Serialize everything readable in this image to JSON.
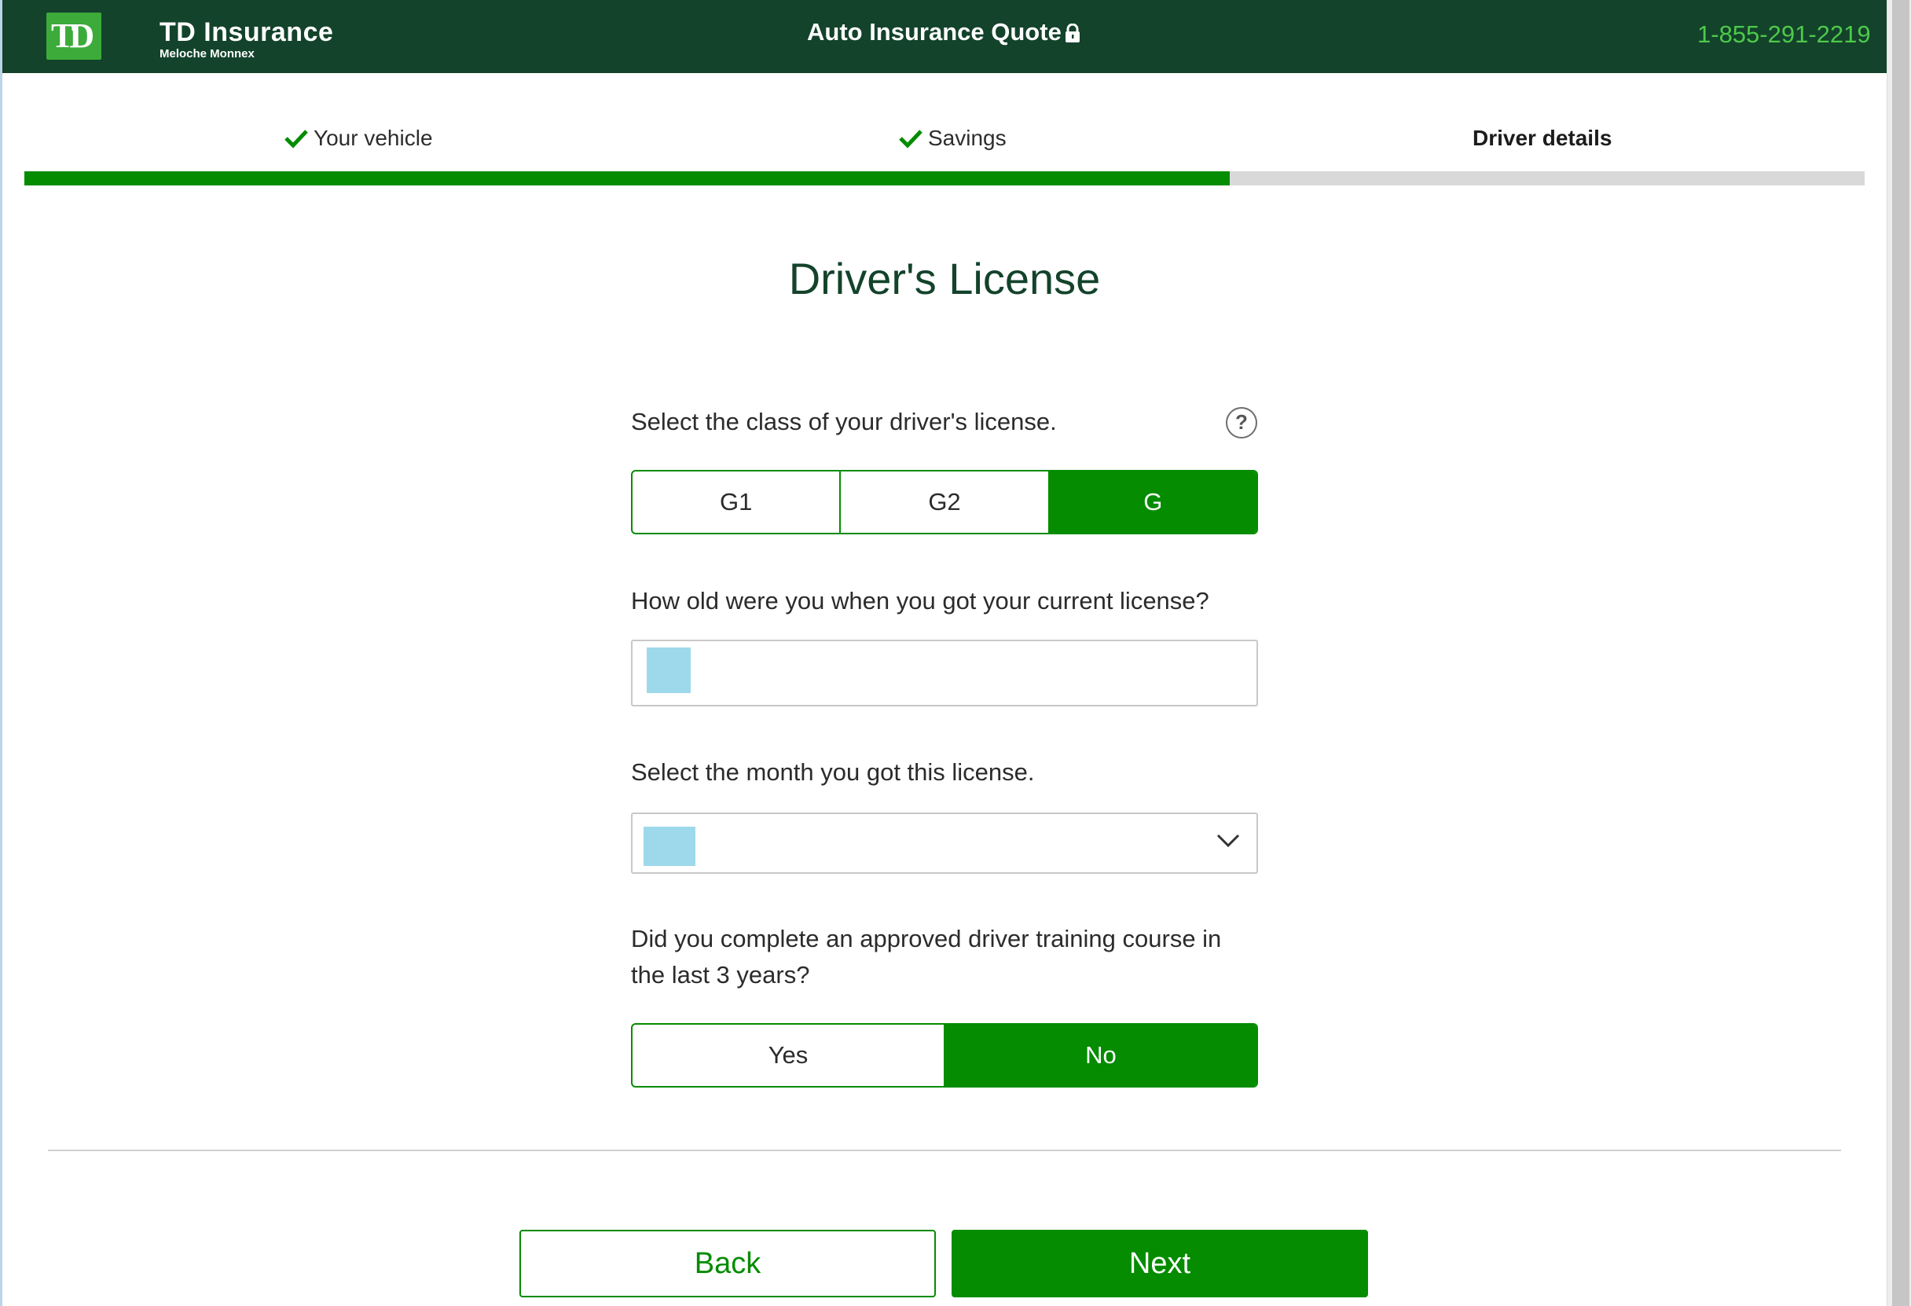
{
  "header": {
    "logo_text": "TD",
    "brand_name": "TD Insurance",
    "brand_sub": "Meloche Monnex",
    "title": "Auto Insurance Quote",
    "phone": "1-855-291-2219"
  },
  "steps": [
    {
      "label": "Your vehicle",
      "status": "complete"
    },
    {
      "label": "Savings",
      "status": "complete"
    },
    {
      "label": "Driver details",
      "status": "active"
    }
  ],
  "progress": {
    "fraction": 0.655
  },
  "main": {
    "title": "Driver's License",
    "license_class": {
      "question": "Select the class of your driver's license.",
      "options": [
        "G1",
        "G2",
        "G"
      ],
      "selected": "G"
    },
    "license_age": {
      "question": "How old were you when you got your current license?",
      "value": ""
    },
    "license_month": {
      "question": "Select the month you got this license.",
      "value": ""
    },
    "training": {
      "question": "Did you complete an approved driver training course in the last 3 years?",
      "options": [
        "Yes",
        "No"
      ],
      "selected": "No"
    }
  },
  "actions": {
    "back_label": "Back",
    "next_label": "Next"
  },
  "colors": {
    "header_bg": "#13432b",
    "accent": "#058c00",
    "phone": "#4ec94a",
    "redaction": "#9ed9eb"
  }
}
